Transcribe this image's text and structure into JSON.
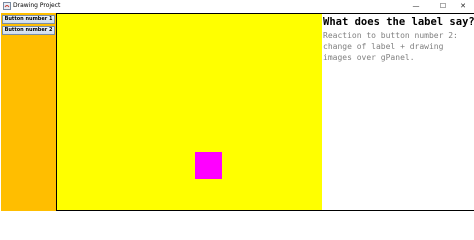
{
  "window": {
    "title": "Drawing Project",
    "controls": {
      "minimize": "—",
      "maximize": "☐",
      "close": "✕"
    }
  },
  "left_panel": {
    "color": "#ffbe00",
    "buttons": [
      {
        "label": "Button number 1"
      },
      {
        "label": "Button number 2"
      }
    ]
  },
  "g_panel": {
    "background": "#ffff00",
    "shape_color": "#ff00ff"
  },
  "info_panel": {
    "title": "What does the label say?",
    "lines": [
      "Reaction to button number 2:",
      "change of label + drawing",
      "images over gPanel."
    ]
  }
}
